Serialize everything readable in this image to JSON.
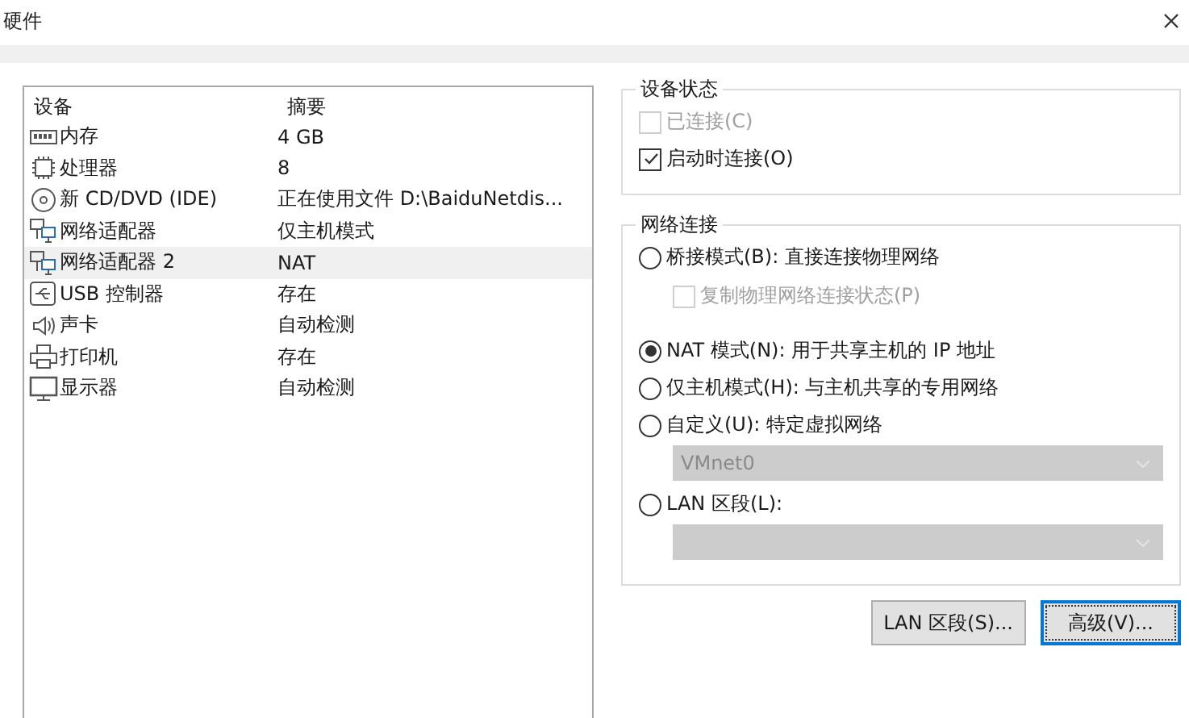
{
  "window": {
    "title": "硬件"
  },
  "device_list": {
    "columns": [
      "设备",
      "摘要"
    ],
    "rows": [
      {
        "kind": "memory",
        "device": "内存",
        "summary": "4 GB",
        "selected": false
      },
      {
        "kind": "cpu",
        "device": "处理器",
        "summary": "8",
        "selected": false
      },
      {
        "kind": "disc",
        "device": "新 CD/DVD (IDE)",
        "summary": "正在使用文件 D:\\BaiduNetdis...",
        "selected": false
      },
      {
        "kind": "network",
        "device": "网络适配器",
        "summary": "仅主机模式",
        "selected": false
      },
      {
        "kind": "network",
        "device": "网络适配器 2",
        "summary": "NAT",
        "selected": true
      },
      {
        "kind": "usb",
        "device": "USB 控制器",
        "summary": "存在",
        "selected": false
      },
      {
        "kind": "sound",
        "device": "声卡",
        "summary": "自动检测",
        "selected": false
      },
      {
        "kind": "printer",
        "device": "打印机",
        "summary": "存在",
        "selected": false
      },
      {
        "kind": "display",
        "device": "显示器",
        "summary": "自动检测",
        "selected": false
      }
    ]
  },
  "device_status": {
    "title": "设备状态",
    "checkboxes": [
      {
        "label": "已连接(C)",
        "checked": false,
        "disabled": true
      },
      {
        "label": "启动时连接(O)",
        "checked": true,
        "disabled": false
      }
    ]
  },
  "network_connection": {
    "title": "网络连接",
    "items": [
      {
        "kind": "radio",
        "label": "桥接模式(B): 直接连接物理网络",
        "selected": false
      },
      {
        "kind": "checkbox",
        "label": "复制物理网络连接状态(P)",
        "checked": false,
        "disabled": true
      },
      {
        "kind": "radio",
        "label": "NAT 模式(N): 用于共享主机的 IP 地址",
        "selected": true
      },
      {
        "kind": "radio",
        "label": "仅主机模式(H): 与主机共享的专用网络",
        "selected": false
      },
      {
        "kind": "radio",
        "label": "自定义(U): 特定虚拟网络",
        "selected": false
      },
      {
        "kind": "dropdown",
        "value": "VMnet0",
        "disabled": true
      },
      {
        "kind": "radio",
        "label": "LAN 区段(L):",
        "selected": false
      },
      {
        "kind": "dropdown",
        "disabled": true
      }
    ]
  },
  "buttons": [
    {
      "label": "LAN 区段(S)...",
      "focused": false
    },
    {
      "label": "高级(V)...",
      "focused": true
    }
  ]
}
